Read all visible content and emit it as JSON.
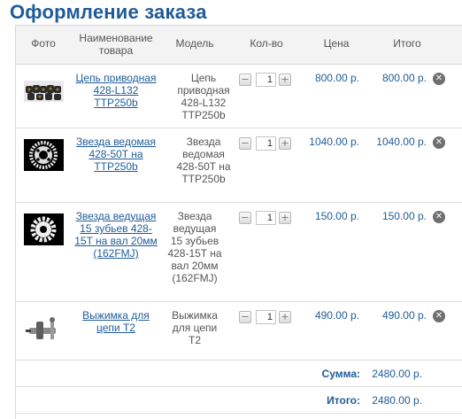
{
  "page": {
    "title": "Оформление заказа"
  },
  "table": {
    "headers": {
      "photo": "Фото",
      "name": "Наименование товара",
      "model": "Модель",
      "qty": "Кол-во",
      "price": "Цена",
      "total": "Итого"
    },
    "rows": [
      {
        "name": "Цепь приводная 428-L132 TTP250b",
        "model": "Цепь приводная 428-L132 TTP250b",
        "qty": "1",
        "price": "800.00 р.",
        "total": "800.00 р.",
        "image": "chain-photo"
      },
      {
        "name": "Звезда ведомая 428-50T на TTP250b",
        "model": "Звезда ведомая 428-50T на TTP250b",
        "qty": "1",
        "price": "1040.00 р.",
        "total": "1040.00 р.",
        "image": "driven-sprocket-photo"
      },
      {
        "name": "Звезда ведущая 15 зубьев 428-15T на вал 20мм (162FMJ)",
        "model": "Звезда ведущая 15 зубьев 428-15T на вал 20мм (162FMJ)",
        "qty": "1",
        "price": "150.00 р.",
        "total": "150.00 р.",
        "image": "drive-sprocket-photo"
      },
      {
        "name": "Выжимка для цепи T2",
        "model": "Выжимка для цепи T2",
        "qty": "1",
        "price": "490.00 р.",
        "total": "490.00 р.",
        "image": "chain-breaker-photo"
      }
    ]
  },
  "summary": {
    "subtotal_label": "Сумма:",
    "subtotal_value": "2480.00 р.",
    "total_label": "Итого:",
    "total_value": "2480.00 р."
  },
  "icons": {
    "minus": "minus-icon",
    "plus": "plus-icon",
    "remove": "remove-icon"
  },
  "colors": {
    "title": "#1f5b98",
    "link": "#1f5b98",
    "header_bg": "#f3f3f3"
  }
}
